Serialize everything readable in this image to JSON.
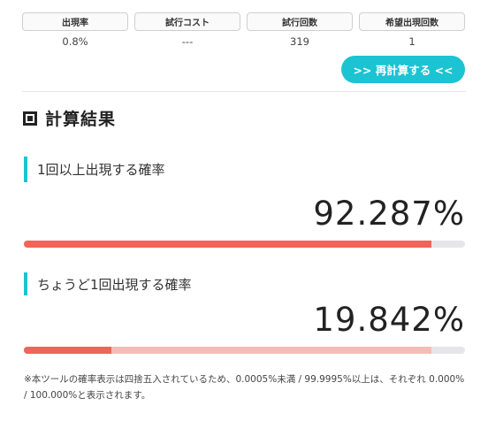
{
  "params": [
    {
      "label": "出現率",
      "value": "0.8%"
    },
    {
      "label": "試行コスト",
      "value": "---"
    },
    {
      "label": "試行回数",
      "value": "319"
    },
    {
      "label": "希望出現回数",
      "value": "1"
    }
  ],
  "recalc_button": ">> 再計算する <<",
  "section_title": "計算結果",
  "results": [
    {
      "label": "1回以上出現する確率",
      "value": "92.287%",
      "fraction": 0.92287
    },
    {
      "label": "ちょうど1回出現する確率",
      "value": "19.842%",
      "fraction": 0.19842,
      "band_fraction": 0.92287
    }
  ],
  "note": "※本ツールの確率表示は四捨五入されているため、0.0005%未満 / 99.9995%以上は、それぞれ 0.000% / 100.000%と表示されます。",
  "colors": {
    "accent": "#1cc3d2",
    "bar_fill": "#f0645a",
    "bar_band": "#f5bcb6",
    "bar_track": "#e6e6ea"
  }
}
